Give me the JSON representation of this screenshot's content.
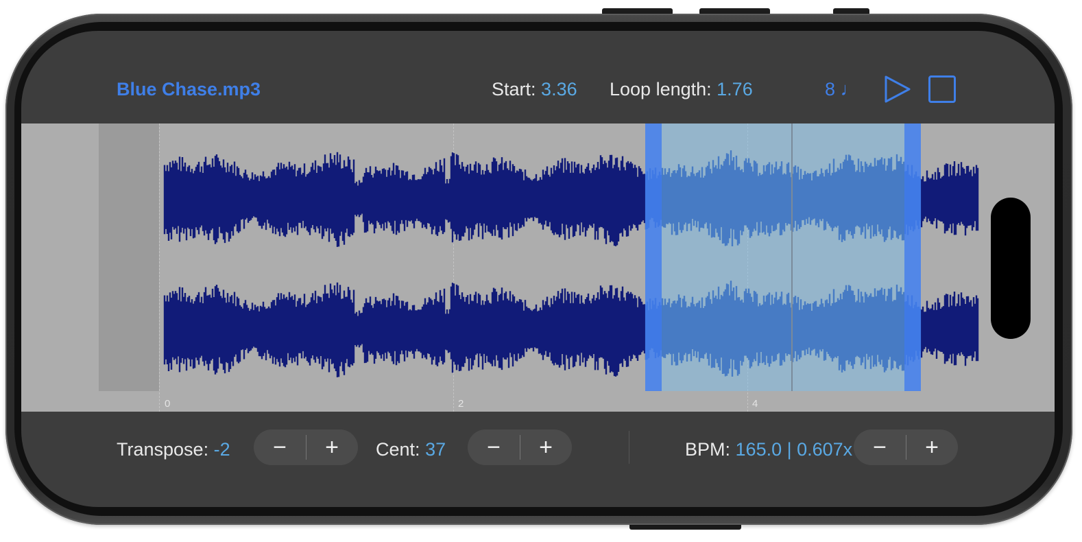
{
  "header": {
    "file_name": "Blue Chase.mp3",
    "start_label": "Start:",
    "start_value": "3.36",
    "loop_length_label": "Loop length:",
    "loop_length_value": "1.76",
    "beats_value": "8",
    "beats_icon": "quarter-note-icon",
    "play_icon": "play-icon",
    "stop_icon": "stop-icon"
  },
  "timeline": {
    "ticks": [
      "0",
      "2",
      "4"
    ]
  },
  "controls": {
    "transpose_label": "Transpose:",
    "transpose_value": "-2",
    "cent_label": "Cent:",
    "cent_value": "37",
    "bpm_label": "BPM:",
    "bpm_value": "165.0 | 0.607x",
    "minus_glyph": "−",
    "plus_glyph": "+"
  },
  "colors": {
    "accent": "#3f7fe8",
    "value": "#5aa9e4",
    "waveform": "#111b78",
    "waveform_in_loop": "#1f44a0",
    "loop_region": "#8ab4c6",
    "background": "#3d3d3d"
  }
}
